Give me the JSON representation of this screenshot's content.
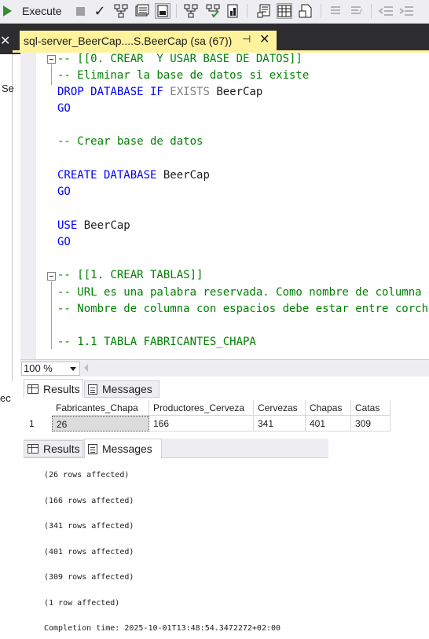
{
  "toolbar": {
    "execute_label": "Execute"
  },
  "left": {
    "fragment_top": "Se",
    "fragment_bottom": "ec"
  },
  "tab": {
    "title": "sql-server_BeerCap....S.BeerCap (sa (67))",
    "pin_glyph": "⊣",
    "close_glyph": "✕"
  },
  "editor": {
    "lines": [
      "-- [[0. CREAR  Y USAR BASE DE DATOS]]",
      "-- Eliminar la base de datos si existe",
      "DROP DATABASE IF EXISTS BeerCap",
      "GO",
      "",
      "-- Crear base de datos",
      "",
      "CREATE DATABASE BeerCap",
      "GO",
      "",
      "USE BeerCap",
      "GO",
      "",
      "-- [[1. CREAR TABLAS]]",
      "-- URL es una palabra reservada. Como nombre de columna debe estar entre corchetes",
      "-- Nombre de columna con espacios debe estar entre corchetes",
      "",
      "-- 1.1 TABLA FABRICANTES_CHAPA"
    ],
    "tokens": {
      "drop_kw": "DROP DATABASE IF",
      "drop_exists": "EXISTS",
      "drop_name": "BeerCap",
      "create_kw": "CREATE DATABASE",
      "create_name": "BeerCap",
      "use_kw": "USE",
      "use_name": "BeerCap",
      "go": "GO"
    }
  },
  "zoom": {
    "value": "100 %"
  },
  "results_tabs": {
    "results": "Results",
    "messages": "Messages"
  },
  "grid": {
    "columns": [
      "Fabricantes_Chapa",
      "Productores_Cerveza",
      "Cervezas",
      "Chapas",
      "Catas"
    ],
    "rows": [
      {
        "row_number": "1",
        "values": [
          "26",
          "166",
          "341",
          "401",
          "309"
        ]
      }
    ]
  },
  "messages": {
    "lines": [
      "(26 rows affected)",
      "(166 rows affected)",
      "(341 rows affected)",
      "(401 rows affected)",
      "(309 rows affected)",
      "(1 row affected)",
      "Completion time: 2025-10-01T13:48:54.3472272+02:00"
    ]
  },
  "colors": {
    "comment": "#008000",
    "keyword": "#0000ff",
    "gray_keyword": "#808080",
    "tab_highlight": "#fff29d",
    "dark_chrome": "#2d2d30"
  }
}
